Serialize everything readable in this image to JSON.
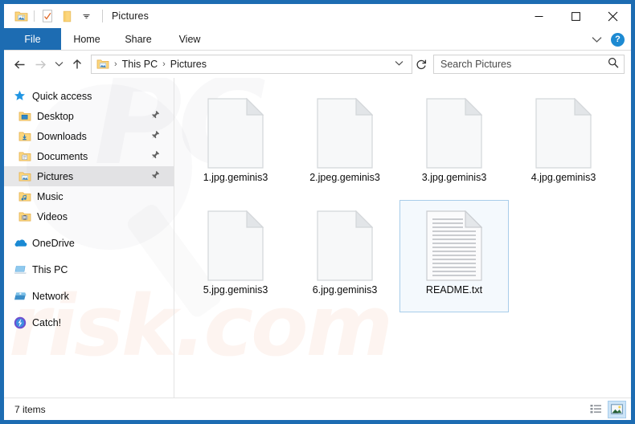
{
  "window": {
    "title": "Pictures",
    "quick_access_toolbar": [
      {
        "name": "pictures-folder-icon",
        "label": "Pictures folder"
      },
      {
        "name": "properties-icon",
        "label": "Properties"
      },
      {
        "name": "new-folder-icon",
        "label": "New folder"
      },
      {
        "name": "chevron-down-icon",
        "label": "Customize Quick Access Toolbar"
      }
    ],
    "controls": {
      "minimize": "–",
      "maximize": "☐",
      "close": "✕"
    }
  },
  "ribbon": {
    "tabs": [
      {
        "label": "File",
        "active": true
      },
      {
        "label": "Home",
        "active": false
      },
      {
        "label": "Share",
        "active": false
      },
      {
        "label": "View",
        "active": false
      }
    ],
    "collapse_label": "∨",
    "help_label": "?"
  },
  "addressbar": {
    "back_label": "←",
    "forward_label": "→",
    "recent_label": "∨",
    "up_label": "↑",
    "breadcrumb": [
      "This PC",
      "Pictures"
    ],
    "breadcrumb_sep": "›",
    "dropdown_label": "∨",
    "refresh_label": "↻"
  },
  "search": {
    "placeholder": "Search Pictures",
    "value": "",
    "icon": "search-icon"
  },
  "sidebar": {
    "groups": [
      {
        "root": {
          "label": "Quick access",
          "icon": "star-icon"
        },
        "items": [
          {
            "label": "Desktop",
            "icon": "desktop-folder-icon",
            "pinned": true,
            "selected": false
          },
          {
            "label": "Downloads",
            "icon": "downloads-folder-icon",
            "pinned": true,
            "selected": false
          },
          {
            "label": "Documents",
            "icon": "documents-folder-icon",
            "pinned": true,
            "selected": false
          },
          {
            "label": "Pictures",
            "icon": "pictures-folder-icon",
            "pinned": true,
            "selected": true
          },
          {
            "label": "Music",
            "icon": "music-folder-icon",
            "pinned": false,
            "selected": false
          },
          {
            "label": "Videos",
            "icon": "videos-folder-icon",
            "pinned": false,
            "selected": false
          }
        ]
      },
      {
        "root": {
          "label": "OneDrive",
          "icon": "onedrive-cloud-icon"
        },
        "items": []
      },
      {
        "root": {
          "label": "This PC",
          "icon": "this-pc-icon"
        },
        "items": []
      },
      {
        "root": {
          "label": "Network",
          "icon": "network-icon"
        },
        "items": []
      },
      {
        "root": {
          "label": "Catch!",
          "icon": "catch-app-icon"
        },
        "items": []
      }
    ]
  },
  "files": [
    {
      "name": "1.jpg.geminis3",
      "icon": "blank-file-icon",
      "selected": false
    },
    {
      "name": "2.jpeg.geminis3",
      "icon": "blank-file-icon",
      "selected": false
    },
    {
      "name": "3.jpg.geminis3",
      "icon": "blank-file-icon",
      "selected": false
    },
    {
      "name": "4.jpg.geminis3",
      "icon": "blank-file-icon",
      "selected": false
    },
    {
      "name": "5.jpg.geminis3",
      "icon": "blank-file-icon",
      "selected": false
    },
    {
      "name": "6.jpg.geminis3",
      "icon": "blank-file-icon",
      "selected": false
    },
    {
      "name": "README.txt",
      "icon": "text-file-icon",
      "selected": true
    }
  ],
  "statusbar": {
    "item_count": "7 items",
    "views": [
      {
        "name": "details-view-button",
        "active": false
      },
      {
        "name": "large-icons-view-button",
        "active": true
      }
    ]
  },
  "watermark": {
    "line1": "risk.com",
    "line2": "PC"
  },
  "colors": {
    "frame_blue": "#1d6cb2",
    "file_tab_blue": "#1d6cb2",
    "selection_border": "#a8cdea",
    "selection_fill": "#cde5f7",
    "help_blue": "#1d8ad2",
    "folder_yellow": "#fcd67d",
    "onedrive_blue": "#1a8ad4"
  }
}
